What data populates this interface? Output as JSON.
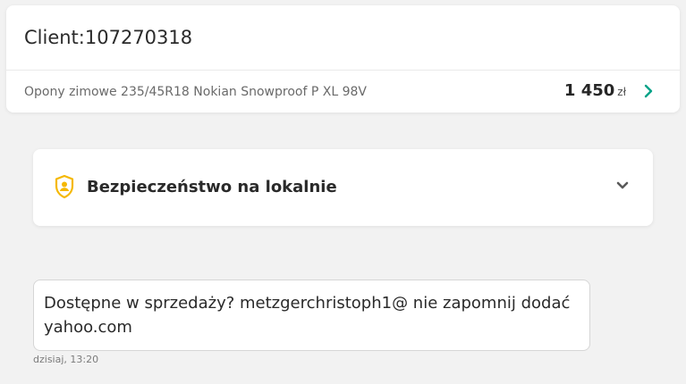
{
  "client": {
    "title": "Client:107270318"
  },
  "product": {
    "name": "Opony zimowe 235/45R18 Nokian Snowproof P XL 98V",
    "price": "1 450",
    "currency": "zł"
  },
  "safety": {
    "title": "Bezpieczeństwo na lokalnie",
    "icon": "shield-user-icon",
    "icon_color": "#f5b800"
  },
  "message": {
    "text": "Dostępne w sprzedaży? metzgerchristoph1@ nie zapomnij dodać yahoo.com",
    "time": "dzisiaj, 13:20"
  },
  "colors": {
    "accent": "#00a287",
    "shield": "#f5b800"
  }
}
